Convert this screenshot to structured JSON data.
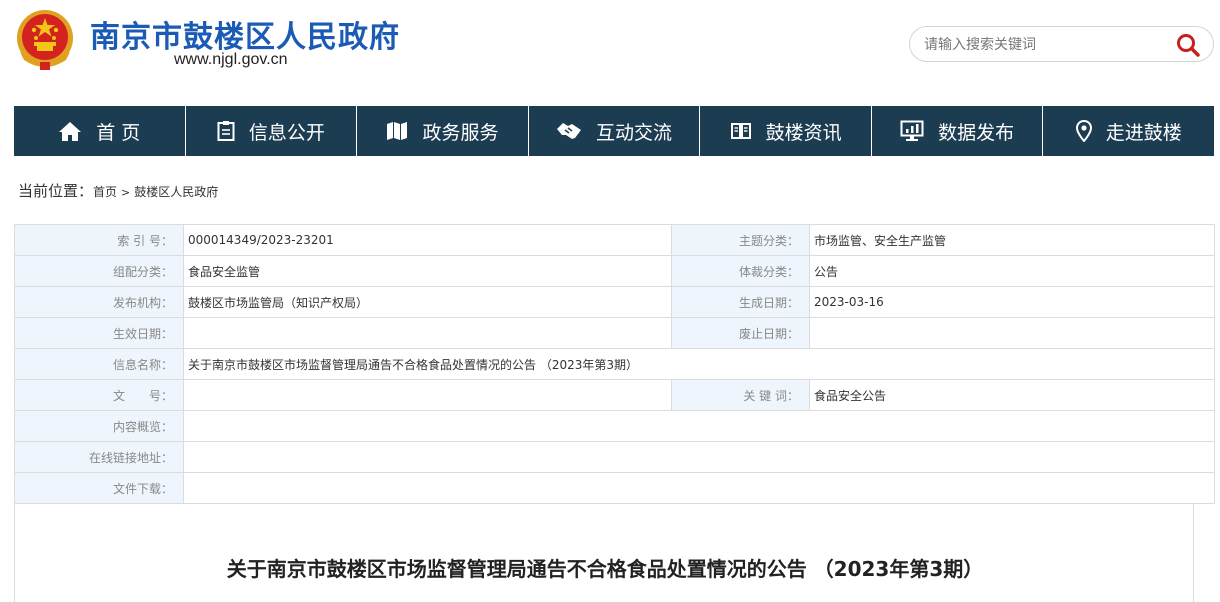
{
  "header": {
    "site_title": "南京市鼓楼区人民政府",
    "site_url": "www.njgl.gov.cn",
    "search_placeholder": "请输入搜索关键词"
  },
  "nav": {
    "items": [
      {
        "label": "首 页",
        "icon": "home-icon"
      },
      {
        "label": "信息公开",
        "icon": "document-icon"
      },
      {
        "label": "政务服务",
        "icon": "map-icon"
      },
      {
        "label": "互动交流",
        "icon": "handshake-icon"
      },
      {
        "label": "鼓楼资讯",
        "icon": "book-icon"
      },
      {
        "label": "数据发布",
        "icon": "monitor-chart-icon"
      },
      {
        "label": "走进鼓楼",
        "icon": "location-pin-icon"
      }
    ]
  },
  "breadcrumb": {
    "label": "当前位置：",
    "separator": ">",
    "items": [
      "首页",
      "鼓楼区人民政府"
    ]
  },
  "meta": {
    "rows": [
      [
        {
          "label": "索 引 号：",
          "value": "000014349/2023-23201"
        },
        {
          "label": "主题分类：",
          "value": "市场监管、安全生产监管"
        }
      ],
      [
        {
          "label": "组配分类：",
          "value": "食品安全监管"
        },
        {
          "label": "体裁分类：",
          "value": "公告"
        }
      ],
      [
        {
          "label": "发布机构：",
          "value": "鼓楼区市场监管局（知识产权局）"
        },
        {
          "label": "生成日期：",
          "value": "2023-03-16"
        }
      ],
      [
        {
          "label": "生效日期：",
          "value": ""
        },
        {
          "label": "废止日期：",
          "value": ""
        }
      ]
    ],
    "info_name_label": "信息名称：",
    "info_name_value": "关于南京市鼓楼区市场监督管理局通告不合格食品处置情况的公告 （2023年第3期）",
    "doc_no_label": "文　　号：",
    "doc_no_value": "",
    "keywords_label": "关 键 词：",
    "keywords_value": "食品安全公告",
    "summary_label": "内容概览：",
    "summary_value": "",
    "online_link_label": "在线链接地址：",
    "online_link_value": "",
    "download_label": "文件下载：",
    "download_value": ""
  },
  "article": {
    "title": "关于南京市鼓楼区市场监督管理局通告不合格食品处置情况的公告 （2023年第3期）"
  },
  "colors": {
    "title_blue": "#1c5bb5",
    "nav_bg": "#1c3c52",
    "label_bg": "#eef5fc",
    "search_icon_red": "#c8201f"
  }
}
